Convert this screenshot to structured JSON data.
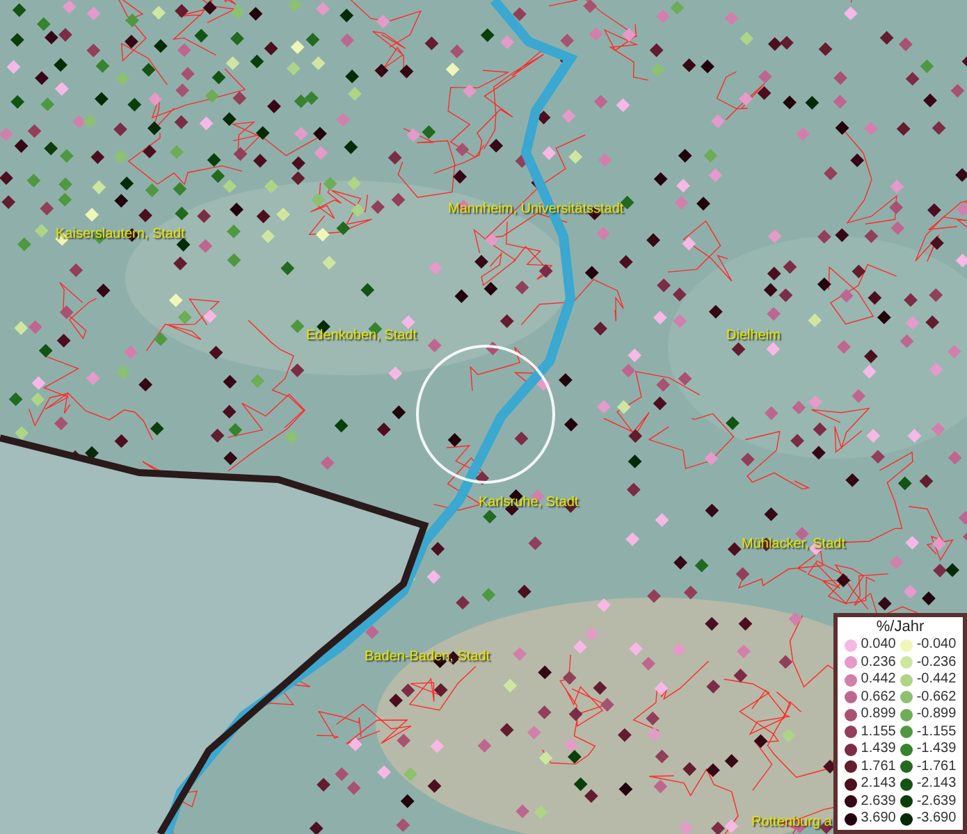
{
  "map": {
    "place_labels": [
      {
        "text": "Mannheim, Universitätsstadt"
      },
      {
        "text": "Kaiserslautern, Stadt"
      },
      {
        "text": "Edenkoben, Stadt"
      },
      {
        "text": "Dielheim"
      },
      {
        "text": "Karlsruhe, Stadt"
      },
      {
        "text": "Mühlacker, Stadt"
      },
      {
        "text": "Baden-Baden, Stadt"
      },
      {
        "text": "Rottenburg a"
      }
    ]
  },
  "legend": {
    "title": "%/Jahr",
    "columns": [
      [
        {
          "label": "0.040",
          "color": "#f7b8e6"
        },
        {
          "label": "0.236",
          "color": "#e59ac9"
        },
        {
          "label": "0.442",
          "color": "#d27fab"
        },
        {
          "label": "0.662",
          "color": "#bf6690"
        },
        {
          "label": "0.899",
          "color": "#a85272"
        },
        {
          "label": "1.155",
          "color": "#933f5a"
        },
        {
          "label": "1.439",
          "color": "#7c2c44"
        },
        {
          "label": "1.761",
          "color": "#641c2f"
        },
        {
          "label": "2.143",
          "color": "#4c0f1f"
        },
        {
          "label": "2.639",
          "color": "#360714"
        },
        {
          "label": "3.690",
          "color": "#22030c"
        }
      ],
      [
        {
          "label": "-0.040",
          "color": "#f0f7b6"
        },
        {
          "label": "-0.236",
          "color": "#cfe6a0"
        },
        {
          "label": "-0.442",
          "color": "#aed486"
        },
        {
          "label": "-0.662",
          "color": "#8cc16d"
        },
        {
          "label": "-0.899",
          "color": "#6cad55"
        },
        {
          "label": "-1.155",
          "color": "#4e9940"
        },
        {
          "label": "-1.439",
          "color": "#37832f"
        },
        {
          "label": "-1.761",
          "color": "#216a20"
        },
        {
          "label": "-2.143",
          "color": "#135414"
        },
        {
          "label": "-2.639",
          "color": "#0a3f0c"
        },
        {
          "label": "-3.690",
          "color": "#052a07"
        }
      ]
    ]
  }
}
